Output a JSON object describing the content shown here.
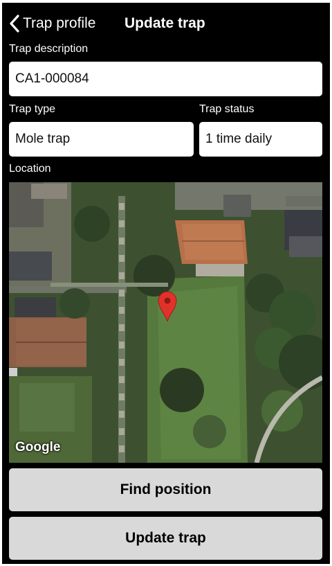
{
  "nav": {
    "back_label": "Trap profile",
    "title": "Update trap"
  },
  "form": {
    "description_label": "Trap description",
    "description_value": "CA1-000084",
    "type_label": "Trap type",
    "type_value": "Mole trap",
    "status_label": "Trap status",
    "status_value": "1 time daily",
    "location_label": "Location"
  },
  "map": {
    "attribution": "Google",
    "marker_icon": "map-pin-icon",
    "marker_color": "#e0322b"
  },
  "buttons": {
    "find_position": "Find position",
    "update_trap": "Update trap"
  },
  "colors": {
    "background": "#000000",
    "field_background": "#ffffff",
    "button_background": "#d9d9d9"
  }
}
